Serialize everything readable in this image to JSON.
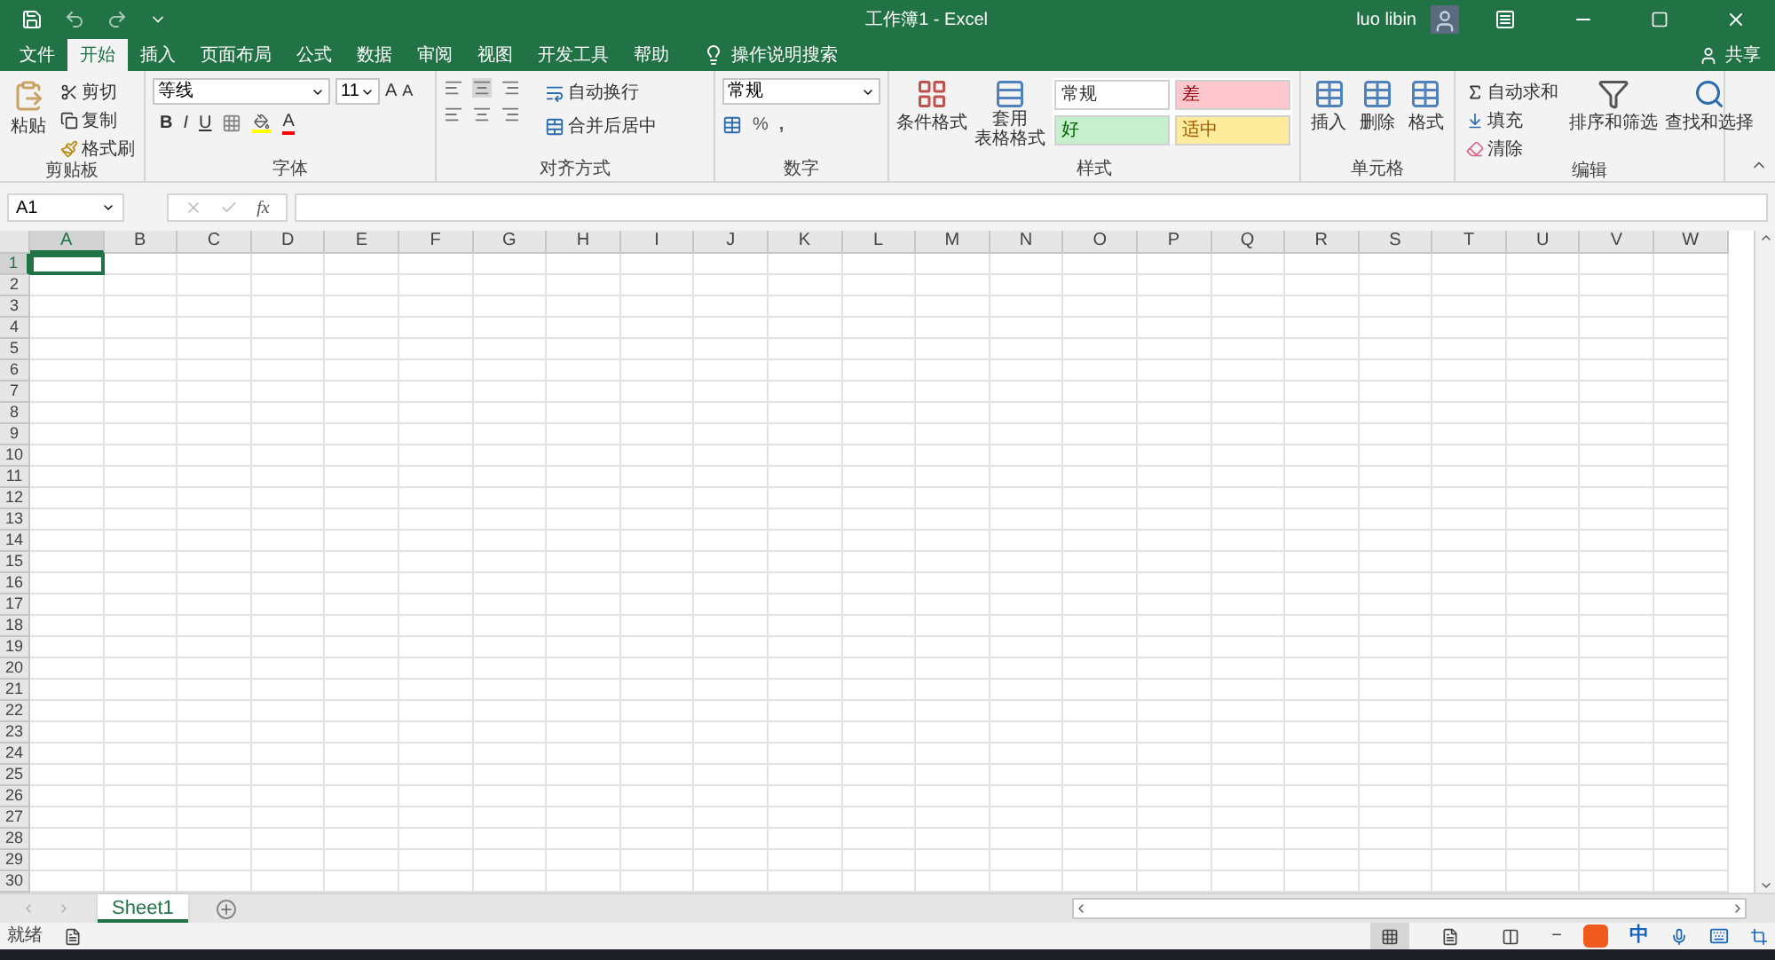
{
  "title_bar": {
    "document_title": "工作簿1 - Excel",
    "user": "luo libin"
  },
  "tabs": [
    {
      "label": "文件",
      "selected": false
    },
    {
      "label": "开始",
      "selected": true
    },
    {
      "label": "插入",
      "selected": false
    },
    {
      "label": "页面布局",
      "selected": false
    },
    {
      "label": "公式",
      "selected": false
    },
    {
      "label": "数据",
      "selected": false
    },
    {
      "label": "审阅",
      "selected": false
    },
    {
      "label": "视图",
      "selected": false
    },
    {
      "label": "开发工具",
      "selected": false
    },
    {
      "label": "帮助",
      "selected": false
    }
  ],
  "tell_me": "操作说明搜索",
  "share": "共享",
  "ribbon": {
    "clipboard": {
      "label": "剪贴板",
      "paste": "粘贴",
      "cut": "剪切",
      "copy": "复制",
      "format_painter": "格式刷"
    },
    "font": {
      "label": "字体",
      "font_name": "等线",
      "font_size": "11",
      "bold": "B",
      "italic": "I",
      "underline": "U",
      "grow": "A",
      "shrink": "A",
      "font_color": "A"
    },
    "alignment": {
      "label": "对齐方式",
      "wrap_text": "自动换行",
      "merge_center": "合并后居中"
    },
    "number": {
      "label": "数字",
      "format": "常规",
      "percent": "%",
      "comma": ","
    },
    "styles": {
      "label": "样式",
      "conditional": "条件格式",
      "table_format": [
        "套用",
        "表格格式"
      ],
      "cell_styles": [
        {
          "label": "常规",
          "color": "#ffffff"
        },
        {
          "label": "差",
          "color": "#ffc7ce"
        },
        {
          "label": "好",
          "color": "#c6efce"
        },
        {
          "label": "适中",
          "color": "#ffeb9c"
        }
      ]
    },
    "cells": {
      "label": "单元格",
      "insert": "插入",
      "delete": "删除",
      "format": "格式"
    },
    "editing": {
      "label": "编辑",
      "autosum": "自动求和",
      "fill": "填充",
      "clear": "清除",
      "sort_filter": "排序和筛选",
      "find_select": "查找和选择"
    }
  },
  "name_box": "A1",
  "fx": "fx",
  "columns": [
    {
      "label": "A",
      "selected": true
    },
    {
      "label": "B",
      "selected": false
    },
    {
      "label": "C",
      "selected": false
    },
    {
      "label": "D",
      "selected": false
    },
    {
      "label": "E",
      "selected": false
    },
    {
      "label": "F",
      "selected": false
    },
    {
      "label": "G",
      "selected": false
    },
    {
      "label": "H",
      "selected": false
    },
    {
      "label": "I",
      "selected": false
    },
    {
      "label": "J",
      "selected": false
    },
    {
      "label": "K",
      "selected": false
    },
    {
      "label": "L",
      "selected": false
    },
    {
      "label": "M",
      "selected": false
    },
    {
      "label": "N",
      "selected": false
    },
    {
      "label": "O",
      "selected": false
    },
    {
      "label": "P",
      "selected": false
    },
    {
      "label": "Q",
      "selected": false
    },
    {
      "label": "R",
      "selected": false
    },
    {
      "label": "S",
      "selected": false
    },
    {
      "label": "T",
      "selected": false
    },
    {
      "label": "U",
      "selected": false
    },
    {
      "label": "V",
      "selected": false
    },
    {
      "label": "W",
      "selected": false
    }
  ],
  "rows": [
    {
      "label": "1",
      "selected": true
    },
    {
      "label": "2",
      "selected": false
    },
    {
      "label": "3",
      "selected": false
    },
    {
      "label": "4",
      "selected": false
    },
    {
      "label": "5",
      "selected": false
    },
    {
      "label": "6",
      "selected": false
    },
    {
      "label": "7",
      "selected": false
    },
    {
      "label": "8",
      "selected": false
    },
    {
      "label": "9",
      "selected": false
    },
    {
      "label": "10",
      "selected": false
    },
    {
      "label": "11",
      "selected": false
    },
    {
      "label": "12",
      "selected": false
    },
    {
      "label": "13",
      "selected": false
    },
    {
      "label": "14",
      "selected": false
    },
    {
      "label": "15",
      "selected": false
    },
    {
      "label": "16",
      "selected": false
    },
    {
      "label": "17",
      "selected": false
    },
    {
      "label": "18",
      "selected": false
    },
    {
      "label": "19",
      "selected": false
    },
    {
      "label": "20",
      "selected": false
    },
    {
      "label": "21",
      "selected": false
    },
    {
      "label": "22",
      "selected": false
    },
    {
      "label": "23",
      "selected": false
    },
    {
      "label": "24",
      "selected": false
    },
    {
      "label": "25",
      "selected": false
    },
    {
      "label": "26",
      "selected": false
    },
    {
      "label": "27",
      "selected": false
    },
    {
      "label": "28",
      "selected": false
    },
    {
      "label": "29",
      "selected": false
    },
    {
      "label": "30",
      "selected": false
    }
  ],
  "sheets": [
    {
      "label": "Sheet1",
      "selected": true
    }
  ],
  "status_bar": {
    "status": "就绪",
    "views": [
      {
        "kind": "normal",
        "selected": true
      },
      {
        "kind": "layout",
        "selected": false
      },
      {
        "kind": "pagebreak",
        "selected": false
      }
    ],
    "ime": "中",
    "zoom_minus": "−"
  }
}
